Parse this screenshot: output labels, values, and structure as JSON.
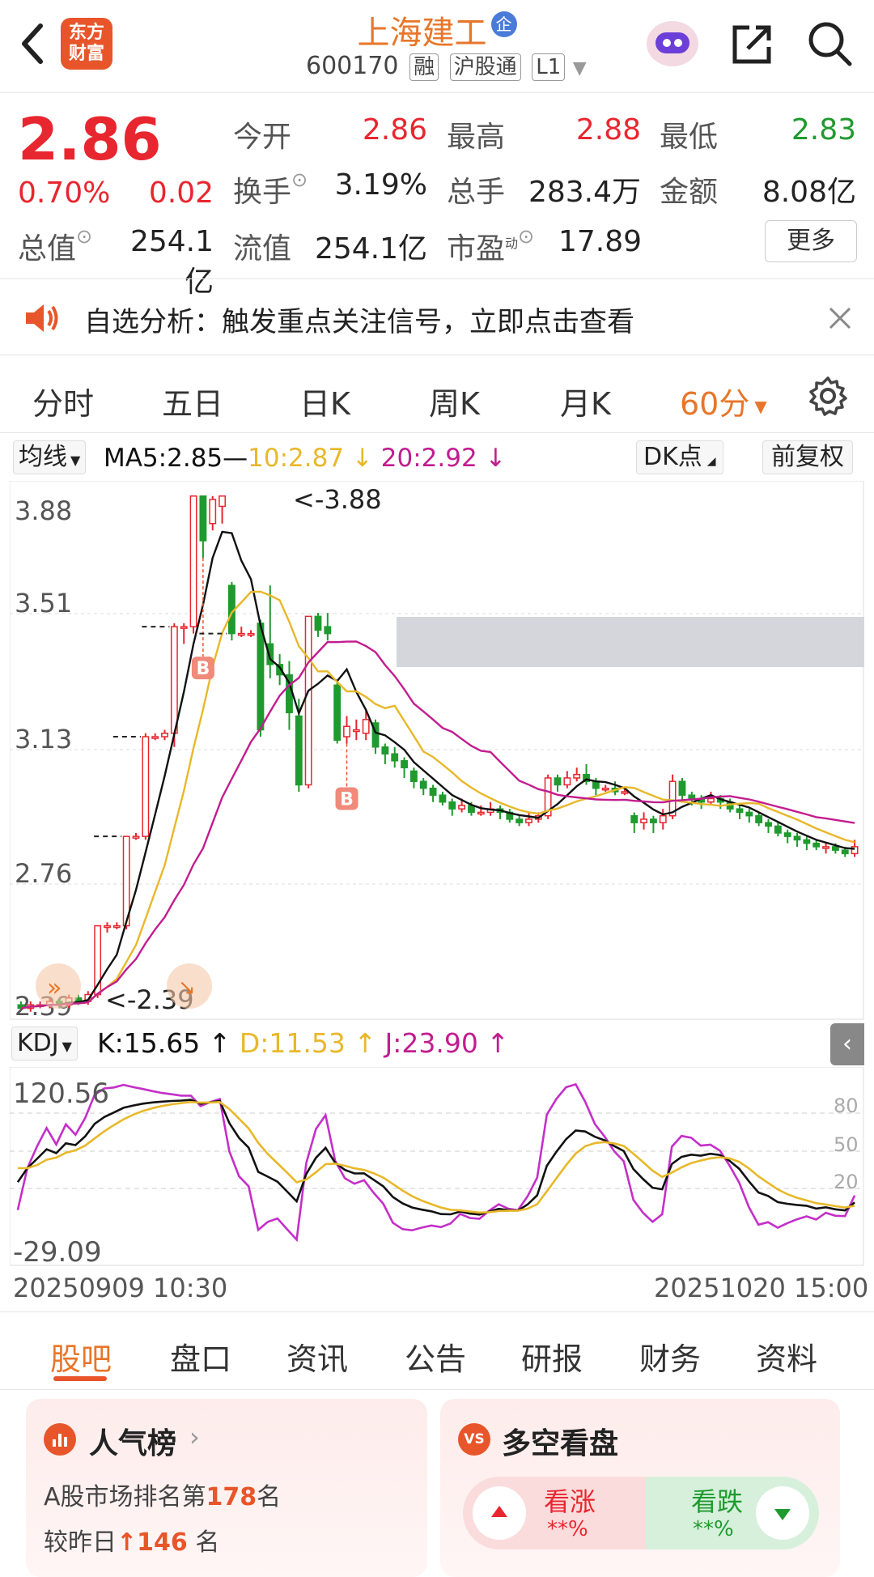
{
  "header": {
    "stock_name": "上海建工",
    "badge": "企",
    "code": "600170",
    "tags": [
      "融",
      "沪股通",
      "L1"
    ],
    "logo_text": [
      "东方",
      "财富"
    ]
  },
  "quote": {
    "price": "2.86",
    "change_pct": "0.70%",
    "change": "0.02",
    "open_label": "今开",
    "open": "2.86",
    "high_label": "最高",
    "high": "2.88",
    "low_label": "最低",
    "low": "2.83",
    "turnover_label": "换手",
    "turnover": "3.19%",
    "volume_label": "总手",
    "volume": "283.4万",
    "amount_label": "金额",
    "amount": "8.08亿",
    "mktcap_label": "总值",
    "mktcap": "254.1亿",
    "float_label": "流值",
    "float": "254.1亿",
    "pe_label": "市盈",
    "pe_sup": "动",
    "pe": "17.89",
    "more_label": "更多"
  },
  "notice": {
    "text": "自选分析：触发重点关注信号，立即点击查看"
  },
  "chart_tabs": [
    "分时",
    "五日",
    "日K",
    "周K",
    "月K",
    "60分"
  ],
  "indicators": {
    "ma_select": "均线",
    "ma5": "MA5:2.85—",
    "ma10": "10:2.87",
    "ma20": "20:2.92",
    "dk": "DK点",
    "adjust": "前复权"
  },
  "kdj": {
    "select": "KDJ",
    "k": "K:15.65",
    "d": "D:11.53",
    "j": "J:23.90"
  },
  "chart_data": {
    "type": "candlestick",
    "price_axis_ticks": [
      "3.88",
      "3.51",
      "3.13",
      "2.76",
      "2.39"
    ],
    "max_annotation": "<-3.88",
    "min_annotation": "<-2.39",
    "kdj_axis_ticks": [
      "120.56",
      "-29.09"
    ],
    "kdj_ref_lines": [
      "80",
      "50",
      "20"
    ],
    "start_time": "20250909 10:30",
    "end_time": "20251020 15:00",
    "buy_marker": "B",
    "colors": {
      "up": "#e8262f",
      "down": "#1f9a2e",
      "ma5": "#111111",
      "ma10": "#e8b82a",
      "ma20": "#c21d8f"
    },
    "candles": [
      [
        2.4,
        2.39,
        2.41,
        2.39
      ],
      [
        2.39,
        2.4,
        2.41,
        2.38
      ],
      [
        2.4,
        2.4,
        2.41,
        2.39
      ],
      [
        2.4,
        2.41,
        2.42,
        2.39
      ],
      [
        2.41,
        2.4,
        2.42,
        2.39
      ],
      [
        2.4,
        2.42,
        2.43,
        2.39
      ],
      [
        2.42,
        2.41,
        2.43,
        2.4
      ],
      [
        2.41,
        2.43,
        2.44,
        2.4
      ],
      [
        2.43,
        2.63,
        2.63,
        2.42
      ],
      [
        2.63,
        2.63,
        2.64,
        2.61
      ],
      [
        2.63,
        2.63,
        2.64,
        2.62
      ],
      [
        2.63,
        2.89,
        2.89,
        2.62
      ],
      [
        2.89,
        2.89,
        2.9,
        2.88
      ],
      [
        2.89,
        3.18,
        3.19,
        2.88
      ],
      [
        3.18,
        3.18,
        3.19,
        3.17
      ],
      [
        3.18,
        3.19,
        3.2,
        3.17
      ],
      [
        3.19,
        3.5,
        3.51,
        3.15
      ],
      [
        3.5,
        3.5,
        3.51,
        3.45
      ],
      [
        3.5,
        3.88,
        3.88,
        3.48
      ],
      [
        3.88,
        3.75,
        3.88,
        3.7
      ],
      [
        3.8,
        3.87,
        3.88,
        3.78
      ],
      [
        3.85,
        3.88,
        3.88,
        3.8
      ],
      [
        3.62,
        3.48,
        3.63,
        3.46
      ],
      [
        3.48,
        3.48,
        3.5,
        3.47
      ],
      [
        3.48,
        3.48,
        3.49,
        3.47
      ],
      [
        3.51,
        3.2,
        3.52,
        3.18
      ],
      [
        3.45,
        3.39,
        3.62,
        3.35
      ],
      [
        3.39,
        3.36,
        3.42,
        3.33
      ],
      [
        3.36,
        3.25,
        3.4,
        3.2
      ],
      [
        3.24,
        3.04,
        3.29,
        3.02
      ],
      [
        3.04,
        3.53,
        3.53,
        3.03
      ],
      [
        3.53,
        3.49,
        3.54,
        3.47
      ],
      [
        3.5,
        3.48,
        3.54,
        3.46
      ],
      [
        3.33,
        3.17,
        3.34,
        3.16
      ],
      [
        3.18,
        3.21,
        3.24,
        3.16
      ],
      [
        3.2,
        3.2,
        3.23,
        3.17
      ],
      [
        3.19,
        3.23,
        3.26,
        3.17
      ],
      [
        3.22,
        3.15,
        3.23,
        3.13
      ],
      [
        3.15,
        3.13,
        3.16,
        3.1
      ],
      [
        3.13,
        3.11,
        3.15,
        3.09
      ],
      [
        3.11,
        3.09,
        3.12,
        3.06
      ],
      [
        3.08,
        3.05,
        3.09,
        3.03
      ],
      [
        3.05,
        3.03,
        3.06,
        3.01
      ],
      [
        3.03,
        3.01,
        3.04,
        2.99
      ],
      [
        3.01,
        2.99,
        3.02,
        2.98
      ],
      [
        2.99,
        2.97,
        3.0,
        2.95
      ],
      [
        2.97,
        2.98,
        3.0,
        2.96
      ],
      [
        2.98,
        2.96,
        2.99,
        2.95
      ],
      [
        2.96,
        2.96,
        2.98,
        2.95
      ],
      [
        2.96,
        2.97,
        2.99,
        2.95
      ],
      [
        2.97,
        2.96,
        2.98,
        2.94
      ],
      [
        2.96,
        2.94,
        2.97,
        2.93
      ],
      [
        2.94,
        2.93,
        2.95,
        2.92
      ],
      [
        2.93,
        2.94,
        2.96,
        2.92
      ],
      [
        2.94,
        2.95,
        2.96,
        2.93
      ],
      [
        2.95,
        3.06,
        3.07,
        2.94
      ],
      [
        3.06,
        3.04,
        3.07,
        3.02
      ],
      [
        3.04,
        3.06,
        3.08,
        3.03
      ],
      [
        3.06,
        3.07,
        3.09,
        3.05
      ],
      [
        3.07,
        3.05,
        3.1,
        3.04
      ],
      [
        3.05,
        3.03,
        3.06,
        3.01
      ],
      [
        3.03,
        3.03,
        3.04,
        3.02
      ],
      [
        3.03,
        3.02,
        3.05,
        3.01
      ],
      [
        3.02,
        3.02,
        3.03,
        3.01
      ],
      [
        2.95,
        2.93,
        2.96,
        2.9
      ],
      [
        2.93,
        2.94,
        2.96,
        2.91
      ],
      [
        2.94,
        2.93,
        2.95,
        2.9
      ],
      [
        2.93,
        2.95,
        2.97,
        2.91
      ],
      [
        2.95,
        3.05,
        3.07,
        2.94
      ],
      [
        3.05,
        3.01,
        3.06,
        2.99
      ],
      [
        3.01,
        3.0,
        3.02,
        2.98
      ],
      [
        3.0,
        2.99,
        3.01,
        2.97
      ],
      [
        2.99,
        3.0,
        3.02,
        2.98
      ],
      [
        3.0,
        2.99,
        3.01,
        2.97
      ],
      [
        2.99,
        2.97,
        3.0,
        2.96
      ],
      [
        2.97,
        2.96,
        2.98,
        2.94
      ],
      [
        2.96,
        2.95,
        2.97,
        2.93
      ],
      [
        2.95,
        2.93,
        2.96,
        2.92
      ],
      [
        2.93,
        2.92,
        2.94,
        2.9
      ],
      [
        2.92,
        2.9,
        2.93,
        2.89
      ],
      [
        2.9,
        2.89,
        2.91,
        2.87
      ],
      [
        2.89,
        2.88,
        2.9,
        2.86
      ],
      [
        2.88,
        2.87,
        2.89,
        2.85
      ],
      [
        2.87,
        2.86,
        2.88,
        2.85
      ],
      [
        2.86,
        2.86,
        2.87,
        2.84
      ],
      [
        2.86,
        2.85,
        2.87,
        2.84
      ],
      [
        2.85,
        2.84,
        2.86,
        2.83
      ],
      [
        2.84,
        2.86,
        2.88,
        2.83
      ]
    ]
  },
  "bottom_tabs": [
    "股吧",
    "盘口",
    "资讯",
    "公告",
    "研报",
    "财务",
    "资料"
  ],
  "popularity": {
    "title": "人气榜",
    "rank_prefix": "A股市场排名第",
    "rank": "178",
    "rank_suffix": "名",
    "change_prefix": "较昨日",
    "change": "146",
    "change_suffix": "名"
  },
  "sentiment": {
    "title": "多空看盘",
    "bull_label": "看涨",
    "bull_value": "**%",
    "bear_label": "看跌",
    "bear_value": "**%"
  }
}
